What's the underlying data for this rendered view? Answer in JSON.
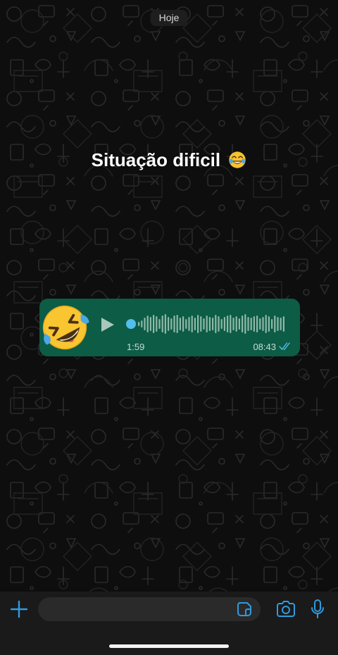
{
  "chat": {
    "date_label": "Hoje",
    "overlay_caption": "Situação dificil",
    "overlay_emoji": "face-with-tears-of-joy",
    "wallpaper": "doodle-pattern-dark"
  },
  "voice_message": {
    "sender_emoji": "rolling-on-the-floor-laughing",
    "duration": "1:59",
    "time": "08:43",
    "status": "read",
    "playback_progress": 0,
    "bubble_color": "#0d5c45",
    "waveform_color": "#8fb8a8",
    "tick_color": "#53bdeb"
  },
  "composer": {
    "placeholder": "",
    "accent_color": "#2f9be0",
    "icons": {
      "attach": "plus-icon",
      "sticker": "sticker-icon",
      "camera": "camera-icon",
      "mic": "microphone-icon"
    }
  }
}
